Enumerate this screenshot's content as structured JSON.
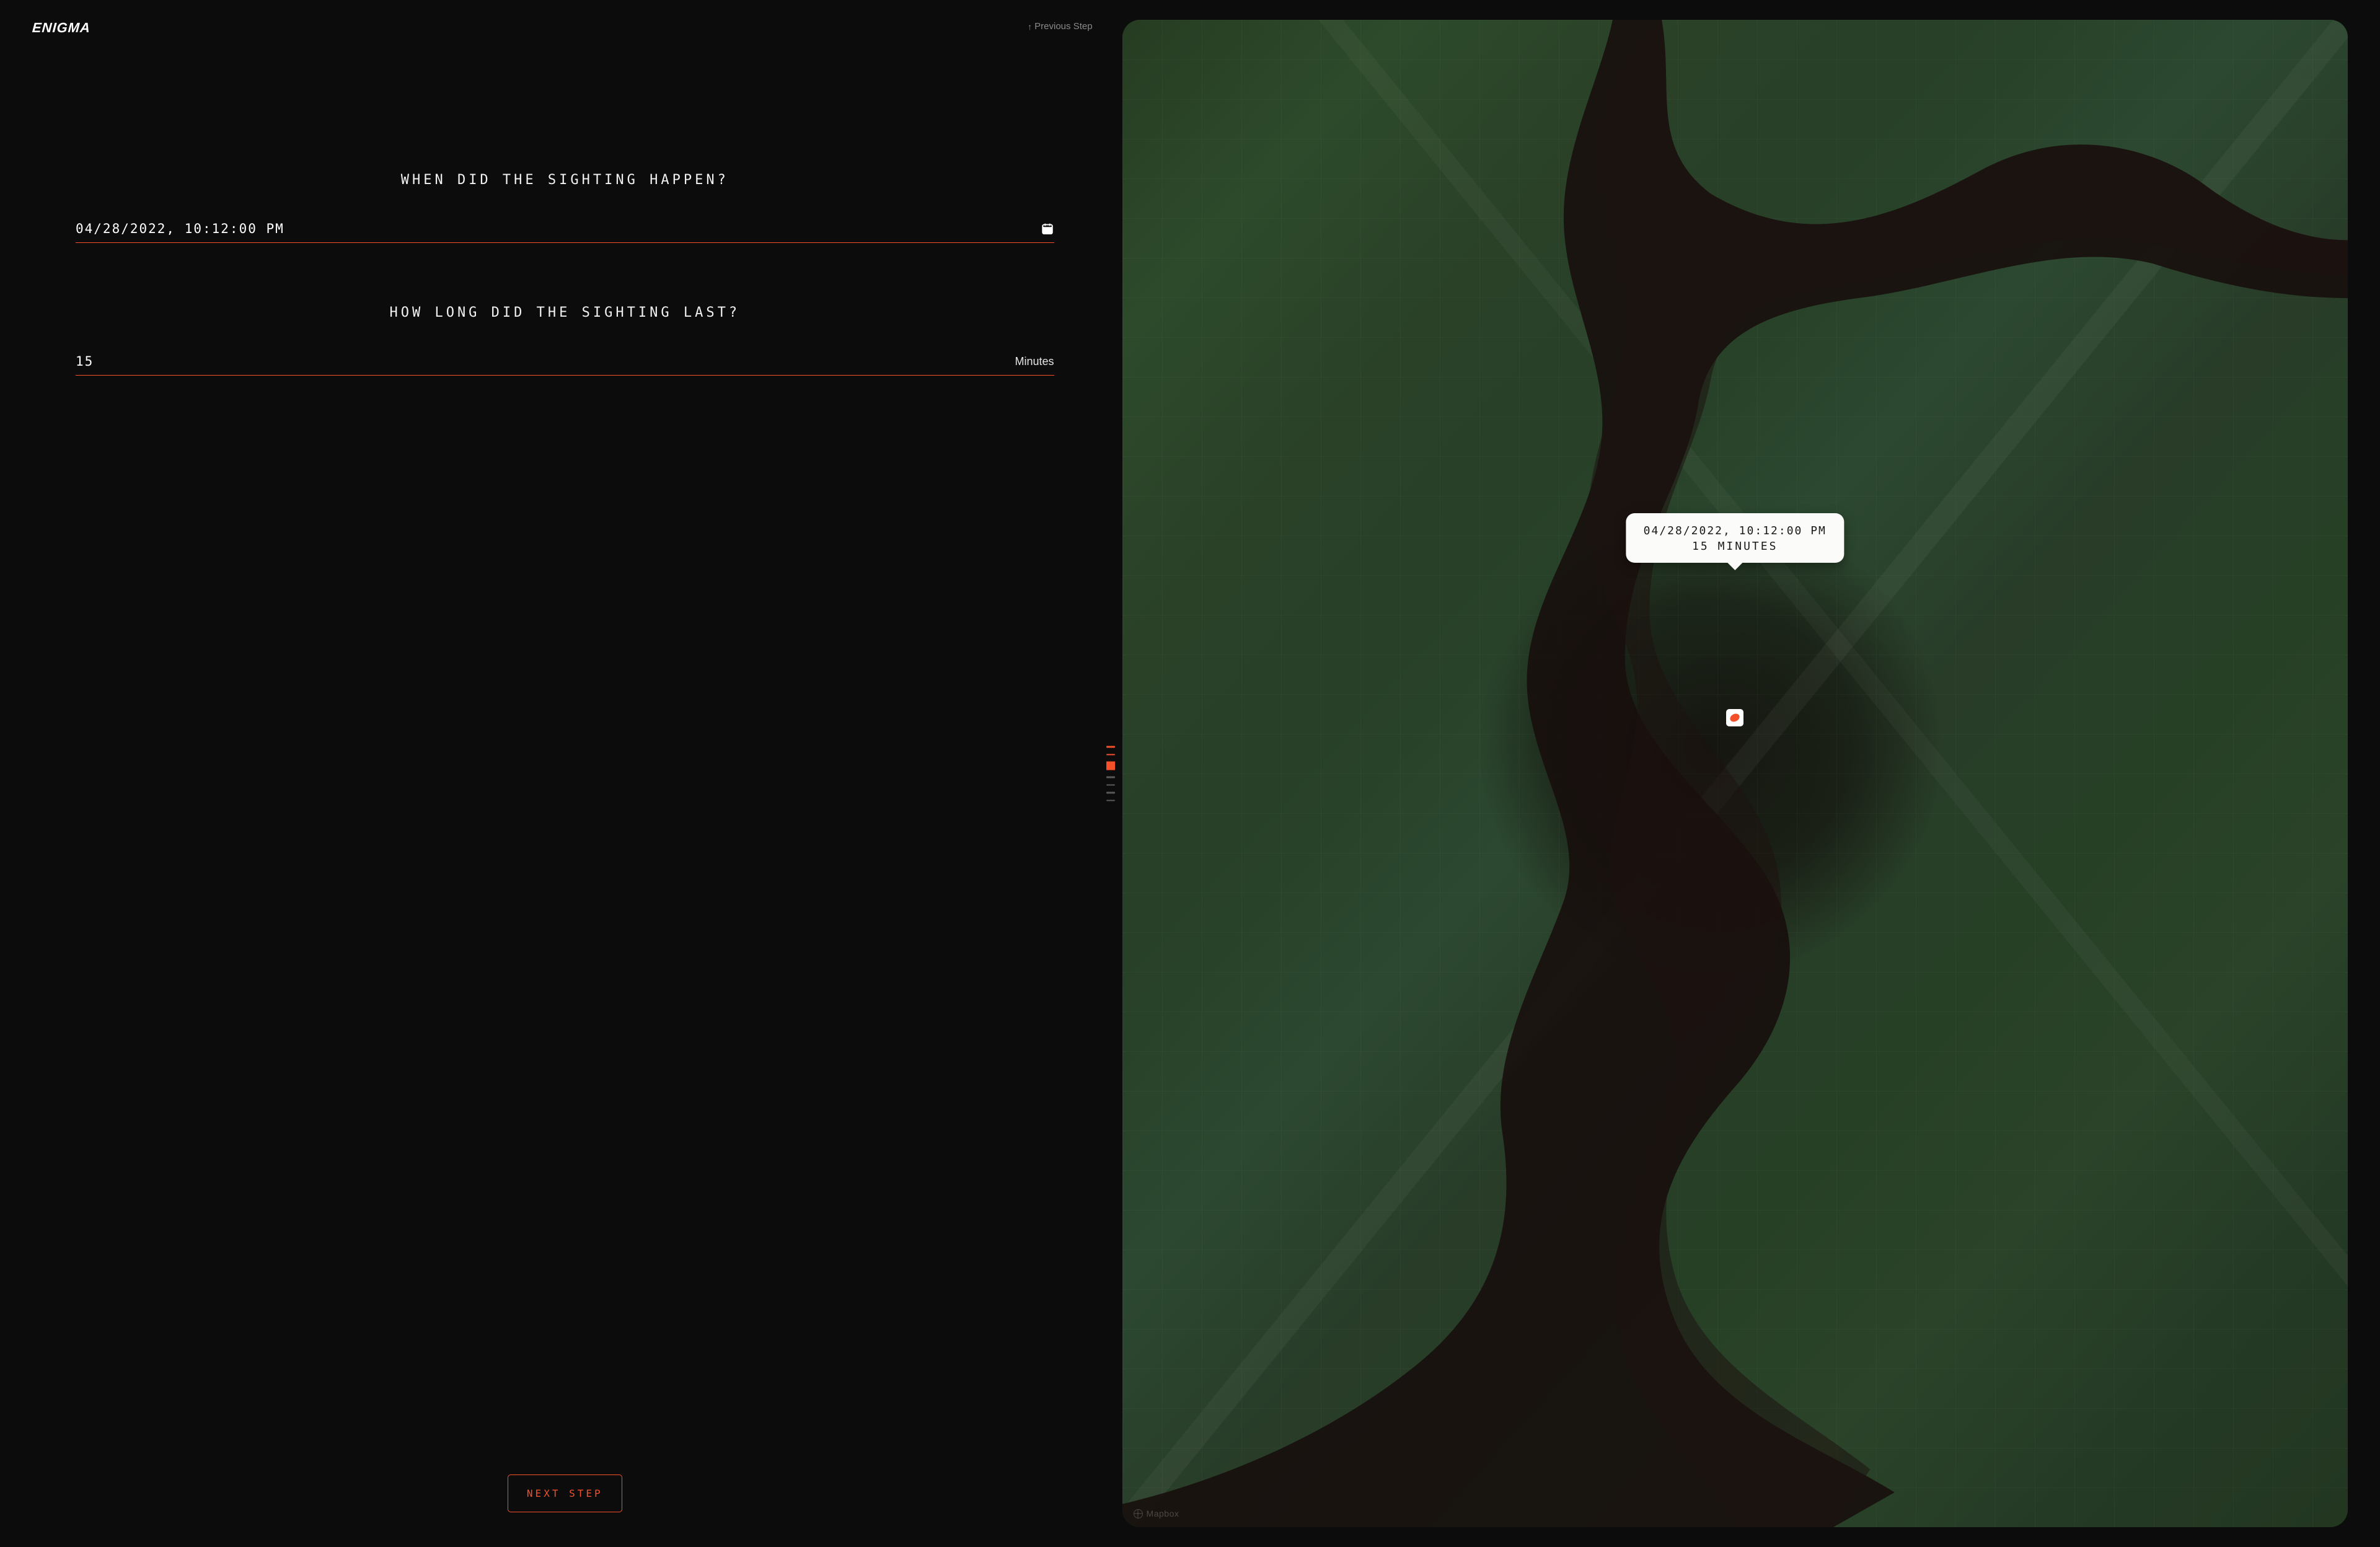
{
  "brand": "ENIGMA",
  "nav": {
    "previous_label": "Previous Step"
  },
  "questions": {
    "when": {
      "label": "WHEN DID THE SIGHTING HAPPEN?",
      "value": "04/28/2022, 10:12:00 PM"
    },
    "duration": {
      "label": "HOW LONG DID THE SIGHTING LAST?",
      "value": "15",
      "unit": "Minutes"
    }
  },
  "actions": {
    "next_label": "NEXT STEP"
  },
  "step_indicator": {
    "total": 7,
    "current_index": 2,
    "completed_indices": [
      0,
      1
    ]
  },
  "map": {
    "tooltip": {
      "line1": "04/28/2022, 10:12:00 PM",
      "line2": "15 MINUTES"
    },
    "attribution": "Mapbox"
  },
  "colors": {
    "accent": "#f4502a",
    "bg": "#0c0c0c"
  }
}
